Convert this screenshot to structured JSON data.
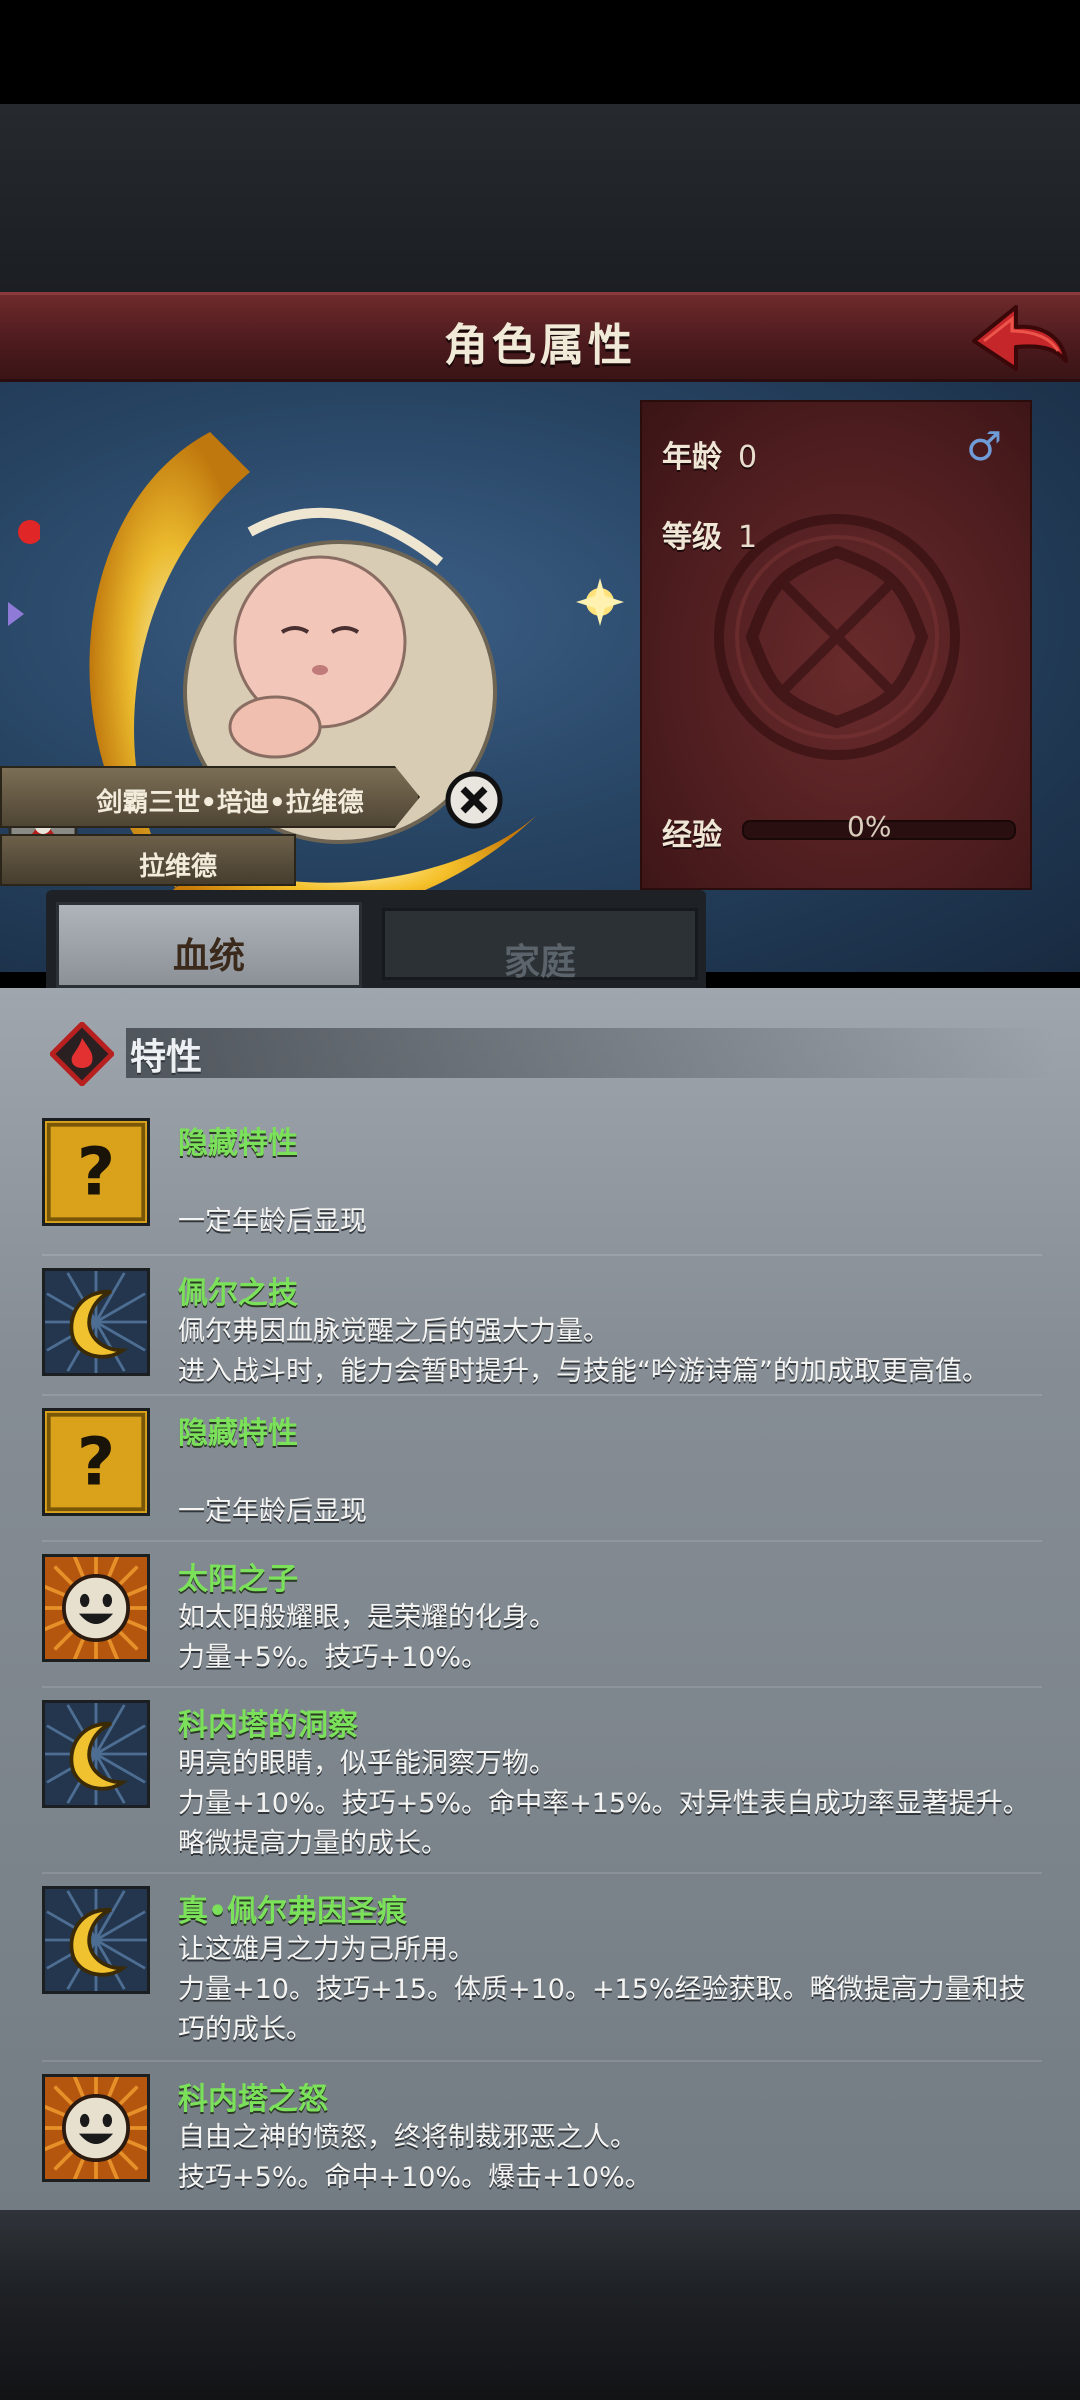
{
  "header": {
    "title": "角色属性"
  },
  "character": {
    "age_label": "年龄",
    "age": "0",
    "level_label": "等级",
    "level": "1",
    "exp_label": "经验",
    "exp_percent": "0%",
    "exp_progress": 0,
    "gender_symbol": "♂",
    "full_name": "剑霸三世•培迪•拉维德",
    "family_name": "拉维德"
  },
  "tabs": [
    {
      "label": "血统",
      "active": true
    },
    {
      "label": "家庭",
      "active": false
    }
  ],
  "section": {
    "label": "特性"
  },
  "traits": [
    {
      "name": "隐藏特性",
      "icon": "question-icon",
      "lines": [
        "",
        "一定年龄后显现"
      ]
    },
    {
      "name": "佩尔之技",
      "icon": "moon-icon",
      "lines": [
        "佩尔弗因血脉觉醒之后的强大力量。",
        "进入战斗时，能力会暂时提升，与技能“吟游诗篇”的加成取更高值。"
      ]
    },
    {
      "name": "隐藏特性",
      "icon": "question-icon",
      "lines": [
        "",
        "一定年龄后显现"
      ]
    },
    {
      "name": "太阳之子",
      "icon": "sun-face-icon",
      "lines": [
        "如太阳般耀眼，是荣耀的化身。",
        "力量+5%。技巧+10%。"
      ]
    },
    {
      "name": "科内塔的洞察",
      "icon": "moon-icon",
      "lines": [
        "明亮的眼睛，似乎能洞察万物。",
        "力量+10%。技巧+5%。命中率+15%。对异性表白成功率显著提升。",
        "略微提高力量的成长。"
      ]
    },
    {
      "name": "真•佩尔弗因圣痕",
      "icon": "moon-icon",
      "lines": [
        "让这雄月之力为己所用。",
        "力量+10。技巧+15。体质+10。+15%经验获取。略微提高力量和技",
        "巧的成长。"
      ]
    },
    {
      "name": "科内塔之怒",
      "icon": "sun-face-icon",
      "lines": [
        "自由之神的愤怒，终将制裁邪恶之人。",
        "技巧+5%。命中+10%。爆击+10%。"
      ]
    }
  ],
  "colors": {
    "trait_name": "#7be15a",
    "header": "#5a2022",
    "gender": "#6f9bd8"
  }
}
